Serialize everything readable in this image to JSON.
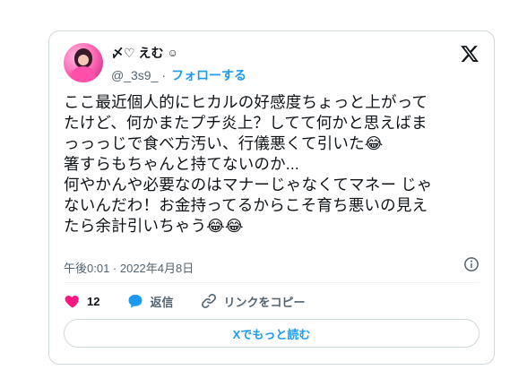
{
  "author": {
    "display_name": "〆♡ えむ",
    "name_emoji": "☺",
    "handle": "@_3s9_",
    "separator": "·",
    "follow_label": "フォローする"
  },
  "tweet": {
    "text": "ここ最近個人的にヒカルの好感度ちょっと上がって\nたけど、何かまたプチ炎上？してて何かと思えばま\nっっっじで食べ方汚い、行儀悪くて引いた😂\n箸すらもちゃんと持てないのか...\n何やかんや必要なのはマナーじゃなくてマネー じゃ\nないんだわ！お金持ってるからこそ育ち悪いの見え\nたら余計引いちゃう😂😂",
    "timestamp": "午後0:01 · 2022年4月8日"
  },
  "actions": {
    "like_count": "12",
    "reply_label": "返信",
    "copy_link_label": "リンクをコピー"
  },
  "footer": {
    "read_more_label": "Xでもっと読む"
  },
  "colors": {
    "accent": "#1d9bf0",
    "like": "#f91880",
    "muted": "#536471",
    "border": "#cfd9de"
  },
  "icons": {
    "platform": "x-logo-icon",
    "info": "info-icon",
    "like": "heart-icon",
    "reply": "reply-bubble-icon",
    "link": "link-icon"
  }
}
